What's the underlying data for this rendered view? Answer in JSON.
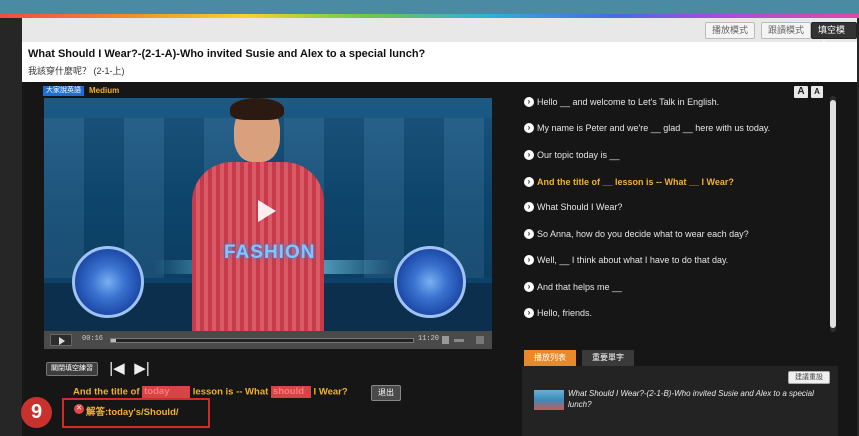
{
  "modes": [
    "播放模式",
    "跟讀模式",
    "填空模式"
  ],
  "active_mode_index": 2,
  "lesson": {
    "title_en": "What Should I Wear?-(2-1-A)-Who invited Susie and Alex to a special lunch?",
    "title_zh": "我該穿什麼呢？ (2-1-上)"
  },
  "video": {
    "channel_tag": "大家說英語",
    "level": "Medium",
    "scene_text": "FASHION",
    "time_current": "00:16",
    "time_total": "11:20",
    "progress": 0.015
  },
  "font_controls": [
    "A",
    "A"
  ],
  "transcript": [
    {
      "text": "Hello __ and welcome to Let's Talk in English.",
      "active": false
    },
    {
      "text": "My name is Peter and we're __ glad __ here with us today.",
      "active": false
    },
    {
      "text": "Our topic today is __",
      "active": false
    },
    {
      "text": "And the title of __ lesson is -- What __ I Wear?",
      "active": true
    },
    {
      "text": "What Should I Wear?",
      "active": false
    },
    {
      "text": "So Anna, how do you decide what to wear each day?",
      "active": false
    },
    {
      "text": "Well, __ I think about what I have to do that day.",
      "active": false
    },
    {
      "text": "And that helps me __",
      "active": false
    },
    {
      "text": "Hello, friends.",
      "active": false
    }
  ],
  "practice": {
    "close_button": "關閉填空練習",
    "prev_icon": "skip-previous-icon",
    "next_icon": "skip-next-icon",
    "sentence": {
      "part1": "And the title of ",
      "blank1": "today",
      "part2": " lesson is -- What ",
      "blank2": "should",
      "part3": " I Wear?"
    },
    "exit_button": "退出",
    "answer_label": "解答:today's/Should/",
    "step_number": "9"
  },
  "tabs": [
    "播放列表",
    "重要單字"
  ],
  "playlist": {
    "recommend_button": "建議重設",
    "items": [
      {
        "title": "What Should I Wear?-(2-1-B)-Who invited Susie and Alex to a special lunch?"
      }
    ]
  }
}
